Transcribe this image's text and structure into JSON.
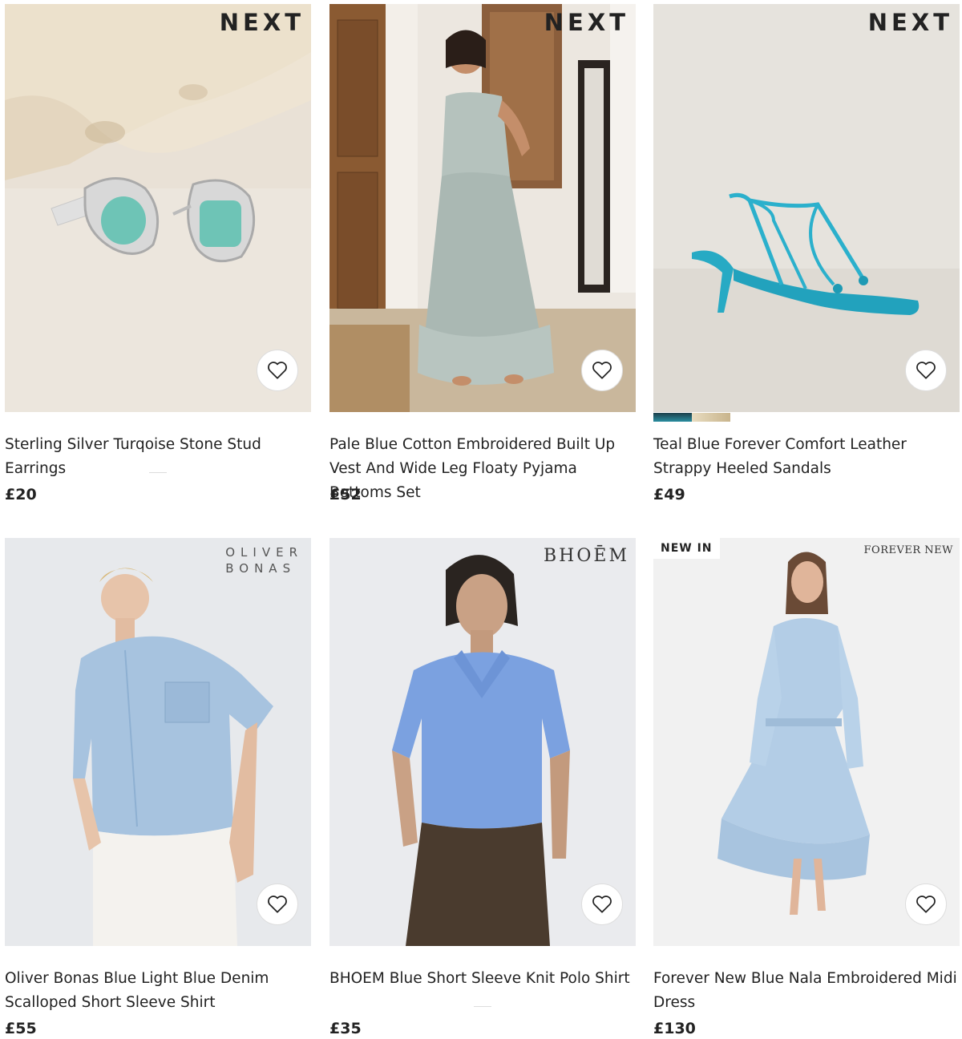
{
  "products": [
    {
      "brand": "NEXT",
      "title": "Sterling Silver Turqoise Stone Stud Earrings",
      "price": "£20"
    },
    {
      "brand": "NEXT",
      "title": "Pale Blue Cotton Embroidered Built Up Vest And Wide Leg Floaty Pyjama Bottoms Set",
      "price": "£52"
    },
    {
      "brand": "NEXT",
      "title": "Teal Blue Forever Comfort Leather Strappy Heeled Sandals",
      "price": "£49",
      "swatches": [
        "#2a8ea0",
        "#d8ccb0"
      ]
    },
    {
      "brand": "OLIVER\nBONAS",
      "title": "Oliver Bonas Blue Light Blue Denim Scalloped Short Sleeve Shirt",
      "price": "£55"
    },
    {
      "brand": "BHOĒM",
      "title": "BHOEM Blue Short Sleeve Knit Polo Shirt",
      "price": "£35"
    },
    {
      "badge": "NEW IN",
      "brand": "FOREVER NEW",
      "title": "Forever New Blue Nala Embroidered Midi Dress",
      "price": "£130"
    }
  ],
  "icons": {
    "favourite": "heart-outline-icon"
  }
}
